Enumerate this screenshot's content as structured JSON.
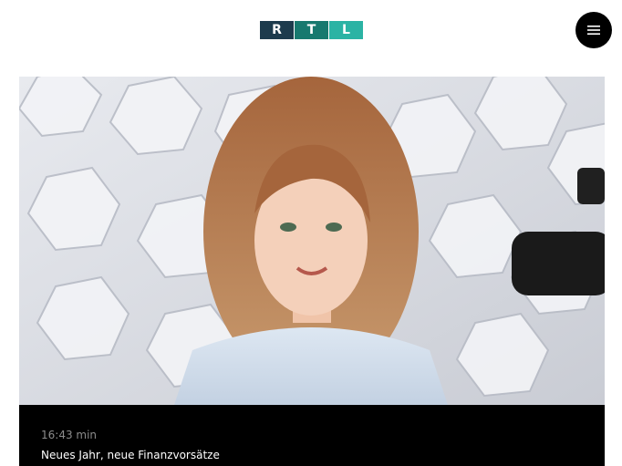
{
  "header": {
    "logo": {
      "letters": [
        "R",
        "T",
        "L"
      ],
      "colors": [
        "#1d3b4d",
        "#17796f",
        "#2bb3a4"
      ]
    },
    "menu_icon": "hamburger-icon"
  },
  "video": {
    "duration": "16:43 min",
    "title": "Neues Jahr, neue Finanzvorsätze",
    "thumbnail_icon": "video-thumbnail-image"
  },
  "colors": {
    "background": "#ffffff",
    "card": "#000000",
    "muted_text": "#8c8c8c",
    "title_text": "#ffffff"
  }
}
